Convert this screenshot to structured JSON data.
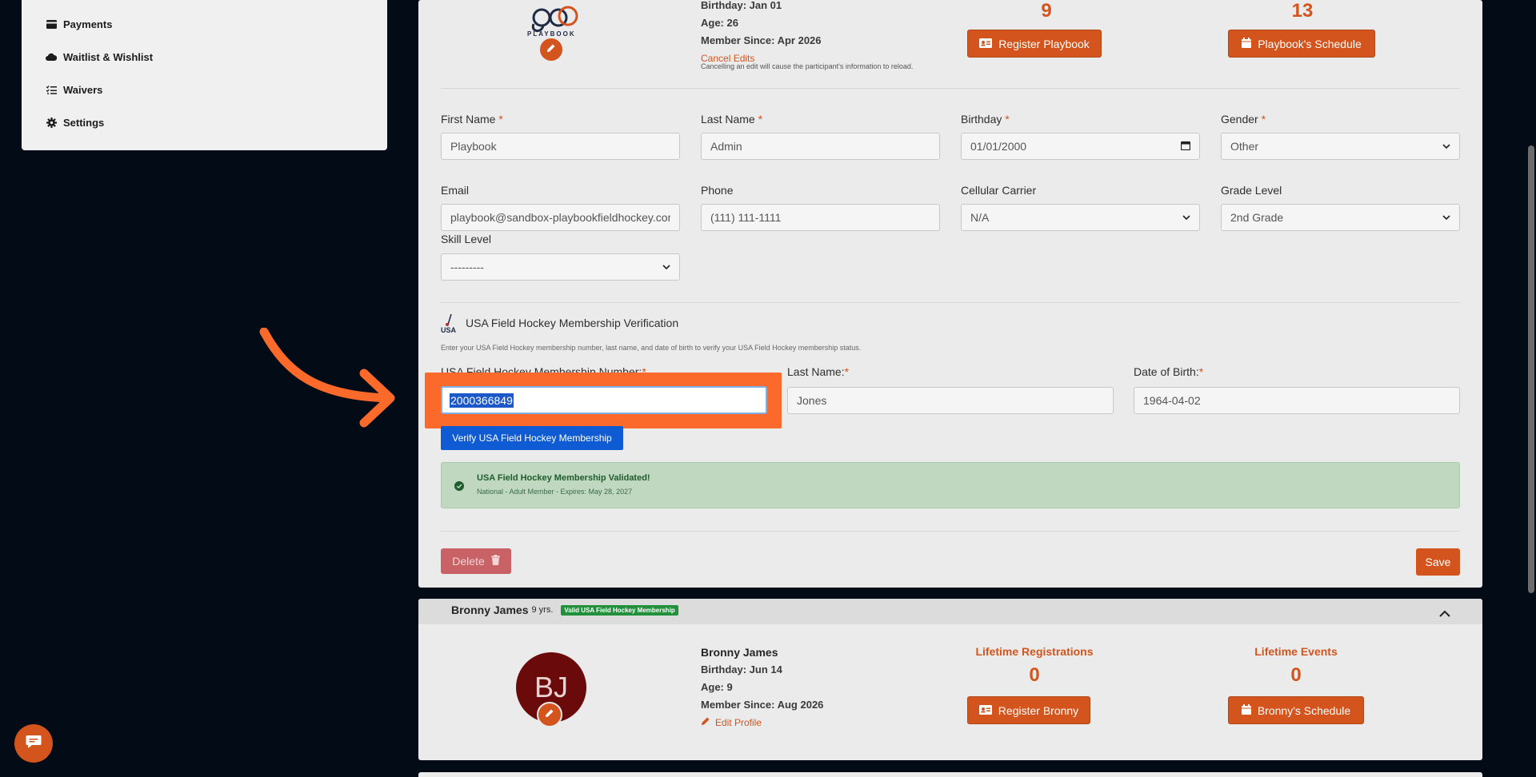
{
  "sidebar": {
    "items": [
      {
        "label": "Payments",
        "icon": "credit-card-icon"
      },
      {
        "label": "Waitlist & Wishlist",
        "icon": "cloud-icon"
      },
      {
        "label": "Waivers",
        "icon": "list-check-icon"
      },
      {
        "label": "Settings",
        "icon": "gear-icon"
      }
    ]
  },
  "profile": {
    "logo_text": "PLAYBOOK",
    "birthday": "Birthday: Jan 01",
    "age": "Age: 26",
    "member_since": "Member Since: Apr 2026",
    "cancel_edits": "Cancel Edits",
    "cancel_note": "Cancelling an edit will cause the participant's information to reload.",
    "registrations_count": "9",
    "events_count": "13",
    "register_button": "Register Playbook",
    "schedule_button": "Playbook's Schedule"
  },
  "form": {
    "first_name_label": "First Name",
    "first_name_value": "Playbook",
    "last_name_label": "Last Name",
    "last_name_value": "Admin",
    "birthday_label": "Birthday",
    "birthday_value": "01/01/2000",
    "gender_label": "Gender",
    "gender_value": "Other",
    "email_label": "Email",
    "email_value": "playbook@sandbox-playbookfieldhockey.com",
    "phone_label": "Phone",
    "phone_value": "(111) 111-1111",
    "carrier_label": "Cellular Carrier",
    "carrier_value": "N/A",
    "grade_label": "Grade Level",
    "grade_value": "2nd Grade",
    "skill_label": "Skill Level",
    "skill_value": "---------",
    "required_mark": "*"
  },
  "usa": {
    "logo_text": "USA",
    "title": "USA Field Hockey Membership Verification",
    "description": "Enter your USA Field Hockey membership number, last name, and date of birth to verify your USA Field Hockey membership status.",
    "number_label": "USA Field Hockey Membership Number:",
    "number_value": "2000366849",
    "last_name_label": "Last Name:",
    "last_name_value": "Jones",
    "dob_label": "Date of Birth:",
    "dob_value": "1964-04-02",
    "verify_button": "Verify USA Field Hockey Membership",
    "alert_title": "USA Field Hockey Membership Validated!",
    "alert_detail": "National - Adult Member - Expires: May 28, 2027"
  },
  "actions": {
    "delete_label": "Delete",
    "save_label": "Save"
  },
  "bronny": {
    "header_name": "Bronny James",
    "header_age": "9 yrs.",
    "badge": "Valid USA Field Hockey Membership",
    "initials": "BJ",
    "name": "Bronny James",
    "birthday": "Birthday: Jun 14",
    "age": "Age: 9",
    "member_since": "Member Since: Aug 2026",
    "edit_profile": "Edit Profile",
    "lifetime_registrations_label": "Lifetime Registrations",
    "lifetime_registrations": "0",
    "lifetime_events_label": "Lifetime Events",
    "lifetime_events": "0",
    "register_button": "Register Bronny",
    "schedule_button": "Bronny's Schedule"
  },
  "colors": {
    "accent": "#d3541c",
    "highlight": "#fb6a2a",
    "background": "#030b17",
    "verify_blue": "#0f5bd3",
    "success_bg": "#bfd8bf"
  }
}
